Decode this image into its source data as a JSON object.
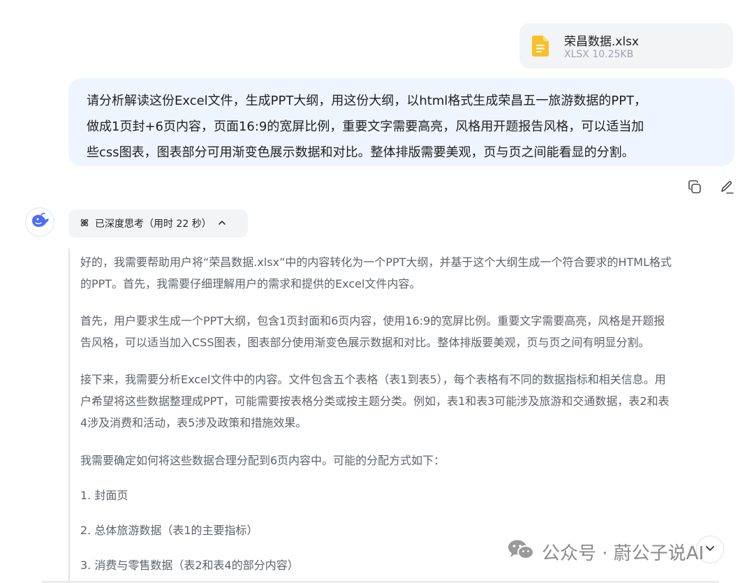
{
  "attachment": {
    "file_name": "荣昌数据.xlsx",
    "file_meta": "XLSX 10.25KB",
    "icon": "spreadsheet-file-icon",
    "icon_color": "#f8c12c"
  },
  "user_message": {
    "lines": [
      "请分析解读这份Excel文件，生成PPT大纲，用这份大纲，以html格式生成荣昌五一旅游数据的PPT，",
      "做成1页封+6页内容，页面16:9的宽屏比例，重要文字需要高亮，风格用开题报告风格，可以适当加",
      "些css图表，图表部分可用渐变色展示数据和对比。整体排版需要美观，页与页之间能看显的分割。"
    ],
    "bubble_color": "#eef5ff"
  },
  "message_actions": {
    "copy_icon": "copy-icon",
    "edit_icon": "edit-icon"
  },
  "assistant": {
    "avatar_icon": "whale-logo-icon",
    "accent": "#4d6bfe",
    "thinking": {
      "label": "已深度思考（用时 22 秒）",
      "icon": "atom-icon",
      "toggle_icon": "chevron-up-icon"
    },
    "reasoning": {
      "p1": [
        "好的，我需要帮助用户将“荣昌数据.xlsx”中的内容转化为一个PPT大纲，并基于这个大纲生成一个符合要求的HTML格式",
        "的PPT。首先，我需要仔细理解用户的需求和提供的Excel文件内容。"
      ],
      "p2": [
        "首先，用户要求生成一个PPT大纲，包含1页封面和6页内容，使用16:9的宽屏比例。重要文字需要高亮，风格是开题报",
        "告风格，可以适当加入CSS图表，图表部分使用渐变色展示数据和对比。整体排版要美观，页与页之间有明显分割。"
      ],
      "p3": [
        "接下来，我需要分析Excel文件中的内容。文件包含五个表格（表1到表5），每个表格有不同的数据指标和相关信息。用",
        "户希望将这些数据整理成PPT，可能需要按表格分类或按主题分类。例如，表1和表3可能涉及旅游和交通数据，表2和表",
        "4涉及消费和活动，表5涉及政策和措施效果。"
      ],
      "p4": "我需要确定如何将这些数据合理分配到6页内容中。可能的分配方式如下：",
      "p5": "1. 封面页",
      "p6": "2. 总体旅游数据（表1的主要指标）",
      "p7": "3. 消费与零售数据（表2和表4的部分内容）"
    }
  },
  "watermark": {
    "text": "公众号 · 蔚公子说AI",
    "icon": "wechat-icon"
  },
  "scroll_button": {
    "icon": "chevron-down-icon"
  }
}
